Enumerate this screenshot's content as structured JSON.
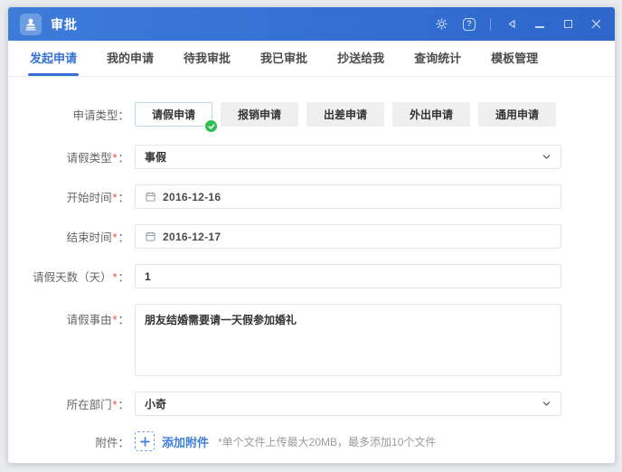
{
  "ui": {
    "colon": "："
  },
  "window": {
    "title": "审批"
  },
  "tabs": [
    {
      "label": "发起申请",
      "active": true
    },
    {
      "label": "我的申请",
      "active": false
    },
    {
      "label": "待我审批",
      "active": false
    },
    {
      "label": "我已审批",
      "active": false
    },
    {
      "label": "抄送给我",
      "active": false
    },
    {
      "label": "查询统计",
      "active": false
    },
    {
      "label": "模板管理",
      "active": false
    }
  ],
  "form": {
    "type_row": {
      "label": "申请类型"
    },
    "type_options": [
      {
        "label": "请假申请",
        "selected": true
      },
      {
        "label": "报销申请",
        "selected": false
      },
      {
        "label": "出差申请",
        "selected": false
      },
      {
        "label": "外出申请",
        "selected": false
      },
      {
        "label": "通用申请",
        "selected": false
      }
    ],
    "leave_type": {
      "label": "请假类型",
      "req": "*",
      "value": "事假"
    },
    "start_date": {
      "label": "开始时间",
      "req": "*",
      "value": "2016-12-16"
    },
    "end_date": {
      "label": "结束时间",
      "req": "*",
      "value": "2016-12-17"
    },
    "days": {
      "label": "请假天数（天）",
      "req": "*",
      "value": "1"
    },
    "reason": {
      "label": "请假事由",
      "req": "*",
      "value": "朋友结婚需要请一天假参加婚礼"
    },
    "department": {
      "label": "所在部门",
      "req": "*",
      "value": "小奇"
    },
    "attachment": {
      "label": "附件",
      "add_label": "添加附件",
      "note": "*单个文件上传最大20MB，最多添加10个文件"
    }
  },
  "colors": {
    "titlebar_blue": "#3370d2",
    "accent_blue": "#3571d6",
    "link_blue": "#3f7fd6",
    "check_green": "#2fbe52",
    "required_red": "#f0453e"
  }
}
